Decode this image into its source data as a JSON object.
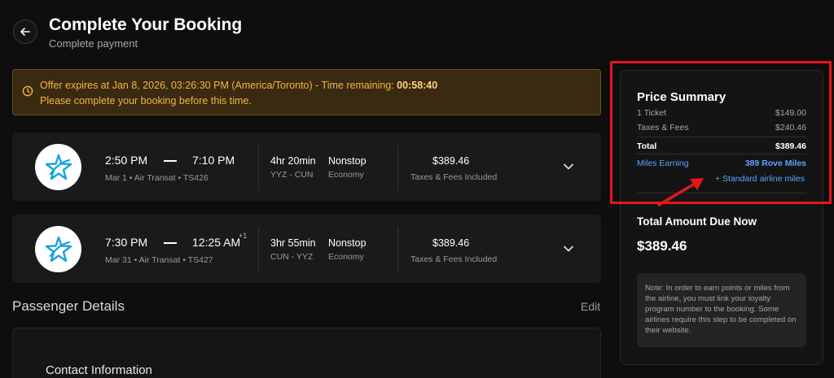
{
  "header": {
    "title": "Complete Your Booking",
    "subtitle": "Complete payment"
  },
  "offer": {
    "message": "Offer expires at Jan 8, 2026, 03:26:30 PM (America/Toronto) - Time remaining: ",
    "countdown": "00:58:40",
    "note": "Please complete your booking before this time.",
    "color": "#f2b544"
  },
  "flights": [
    {
      "depart_time": "2:50 PM",
      "arrive_time": "7:10 PM",
      "day_offset": "",
      "details": "Mar 1 • Air Transat • TS426",
      "duration": "4hr 20min",
      "route": "YYZ - CUN",
      "stops": "Nonstop",
      "cabin": "Economy",
      "price": "$389.46",
      "price_note": "Taxes & Fees Included"
    },
    {
      "depart_time": "7:30 PM",
      "arrive_time": "12:25 AM",
      "day_offset": "+1",
      "details": "Mar 31 • Air Transat • TS427",
      "duration": "3hr 55min",
      "route": "CUN - YYZ",
      "stops": "Nonstop",
      "cabin": "Economy",
      "price": "$389.46",
      "price_note": "Taxes & Fees Included"
    }
  ],
  "passenger": {
    "title": "Passenger Details",
    "edit": "Edit",
    "contact_title": "Contact Information"
  },
  "summary": {
    "title": "Price Summary",
    "ticket_label": "1 Ticket",
    "ticket_value": "$149.00",
    "taxes_label": "Taxes & Fees",
    "taxes_value": "$240.46",
    "total_label": "Total",
    "total_value": "$389.46",
    "miles_label": "Miles Earning",
    "miles_value": "389 Rove Miles",
    "standard_miles": "+ Standard airline miles",
    "due_title": "Total Amount Due Now",
    "due_amount": "$389.46",
    "note": "Note: In order to earn points or miles from the airline, you must link your loyalty program number to the booking. Some airlines require this step to be completed on their website.",
    "accent": "#5aa6ff"
  },
  "annotation": {
    "color": "#e8151b"
  }
}
